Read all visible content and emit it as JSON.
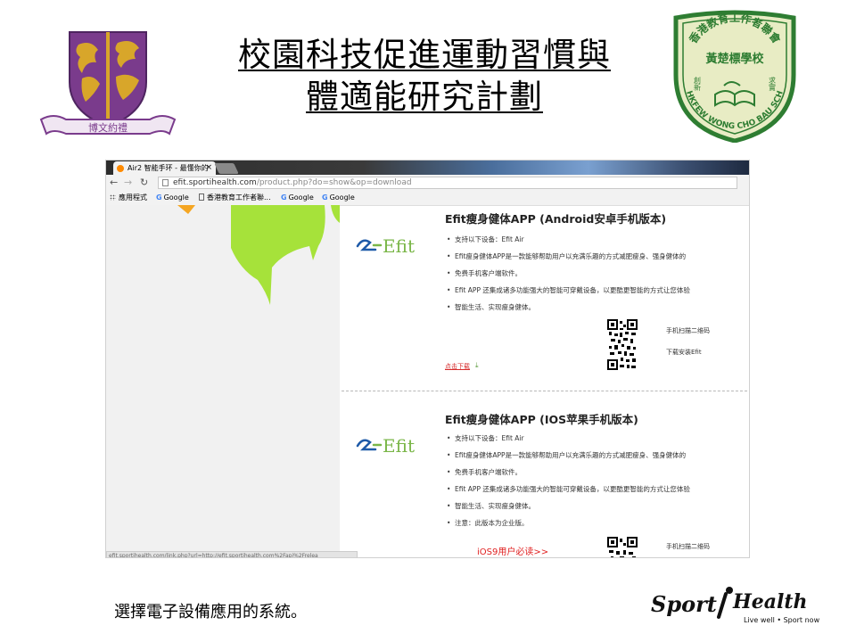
{
  "slide": {
    "title_line1": "校園科技促進運動習慣與",
    "title_line2": "體適能研究計劃",
    "caption": "選擇電子設備應用的系統。"
  },
  "cuhk_logo": {
    "motto_script": "博文約禮"
  },
  "school_logo": {
    "top_text": "香港教育工作者聯會",
    "name": "黃楚標學校",
    "left_motto": "創新",
    "right_motto": "求實",
    "english": "HKFEW WONG CHO BAU SCH"
  },
  "browser": {
    "tab_title": "Air2 智能手环 - 最懂你的",
    "tab_close": "×",
    "url_host": "efit.sportihealth.com",
    "url_path": "/product.php?do=show&op=download",
    "bookmarks": [
      {
        "label": "應用程式",
        "icon": "apps-icon"
      },
      {
        "label": "Google",
        "icon": "google-icon"
      },
      {
        "label": "香港教育工作者聯...",
        "icon": "doc-icon"
      },
      {
        "label": "Google",
        "icon": "google-icon"
      },
      {
        "label": "Google",
        "icon": "google-icon"
      }
    ],
    "status_url": "efit.sportihealth.com/link.php?url=http://efit.sportihealth.com%2Fapi%2Frelea"
  },
  "android_app": {
    "title": "Efit瘦身健体APP (Android安卓手机版本)",
    "logo_text": "Efit",
    "features": [
      "支持以下设备：Efit Air",
      "Efit瘦身健体APP是一款能够帮助用户以充满乐趣的方式减肥瘦身、强身健体的",
      "免费手机客户端软件。",
      "Efit APP 还集成诸多功能强大的智能可穿戴设备，以更酷更智能的方式让您体验",
      "智能生活、实现瘦身健体。"
    ],
    "qr_line1": "手机扫描二维码",
    "qr_line2": "下载安装Efit",
    "download_label": "点击下载"
  },
  "ios_app": {
    "title": "Efit瘦身健体APP (IOS苹果手机版本)",
    "logo_text": "Efit",
    "features": [
      "支持以下设备：Efit Air",
      "Efit瘦身健体APP是一款能够帮助用户以充满乐趣的方式减肥瘦身、强身健体的",
      "免费手机客户端软件。",
      "Efit APP 还集成诸多功能强大的智能可穿戴设备，以更酷更智能的方式让您体验",
      "智能生活、实现瘦身健体。",
      "注意：此版本为企业版。"
    ],
    "ios9_link": "iOS9用户必读>>",
    "qr_line1": "手机扫描二维码"
  },
  "sportihealth_logo": {
    "brand_left": "Sport",
    "brand_right": "Health",
    "tagline": "Live well • Sport now"
  },
  "colors": {
    "cuhk_purple": "#7a3b8c",
    "cuhk_gold": "#d8a62a",
    "school_green": "#2e7d32",
    "school_fill": "#e8ecc4",
    "efit_green": "#7ab648",
    "efit_blue": "#1e5aa8",
    "link_red": "#d62b2b"
  }
}
